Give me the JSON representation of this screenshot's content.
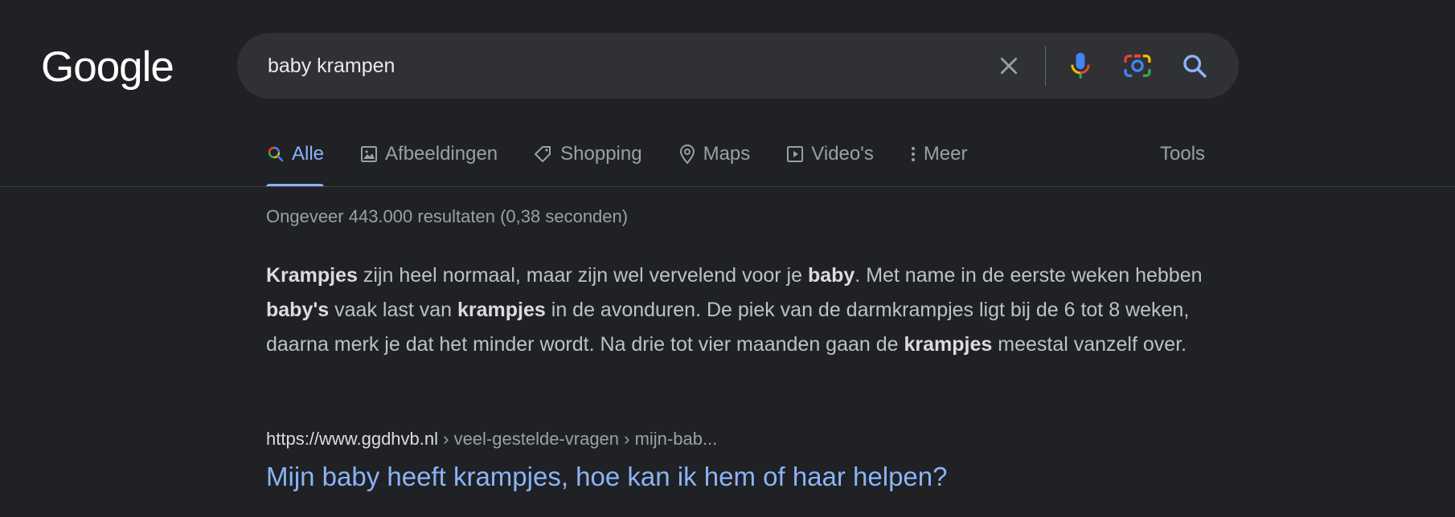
{
  "logo": {
    "text": "Google"
  },
  "search": {
    "value": "baby krampen",
    "clear_icon": "close-icon",
    "mic_icon": "microphone-icon",
    "lens_icon": "camera-lens-icon",
    "search_icon": "search-icon"
  },
  "tabs": [
    {
      "label": "Alle",
      "icon": "search-multicolor-icon",
      "active": true
    },
    {
      "label": "Afbeeldingen",
      "icon": "image-icon",
      "active": false
    },
    {
      "label": "Shopping",
      "icon": "tag-icon",
      "active": false
    },
    {
      "label": "Maps",
      "icon": "map-pin-icon",
      "active": false
    },
    {
      "label": "Video's",
      "icon": "play-icon",
      "active": false
    },
    {
      "label": "Meer",
      "icon": "more-vertical-icon",
      "active": false
    }
  ],
  "tools_label": "Tools",
  "stats": "Ongeveer 443.000 resultaten (0,38 seconden)",
  "snippet": {
    "segments": [
      {
        "text": "Krampjes",
        "bold": true
      },
      {
        "text": " zijn heel normaal, maar zijn wel vervelend voor je ",
        "bold": false
      },
      {
        "text": "baby",
        "bold": true
      },
      {
        "text": ". Met name in de eerste weken hebben ",
        "bold": false
      },
      {
        "text": "baby's",
        "bold": true
      },
      {
        "text": " vaak last van ",
        "bold": false
      },
      {
        "text": "krampjes",
        "bold": true
      },
      {
        "text": " in de avonduren. De piek van de darmkrampjes ligt bij de 6 tot 8 weken, daarna merk je dat het minder wordt. Na drie tot vier maanden gaan de ",
        "bold": false
      },
      {
        "text": "krampjes",
        "bold": true
      },
      {
        "text": " meestal vanzelf over.",
        "bold": false
      }
    ]
  },
  "result": {
    "cite_domain": "https://www.ggdhvb.nl",
    "cite_path": " › veel-gestelde-vragen › mijn-bab...",
    "title": "Mijn baby heeft krampjes, hoe kan ik hem of haar helpen?"
  },
  "colors": {
    "background": "#202124",
    "searchbar": "#303134",
    "link": "#8ab4f8",
    "muted": "#9aa0a6"
  }
}
